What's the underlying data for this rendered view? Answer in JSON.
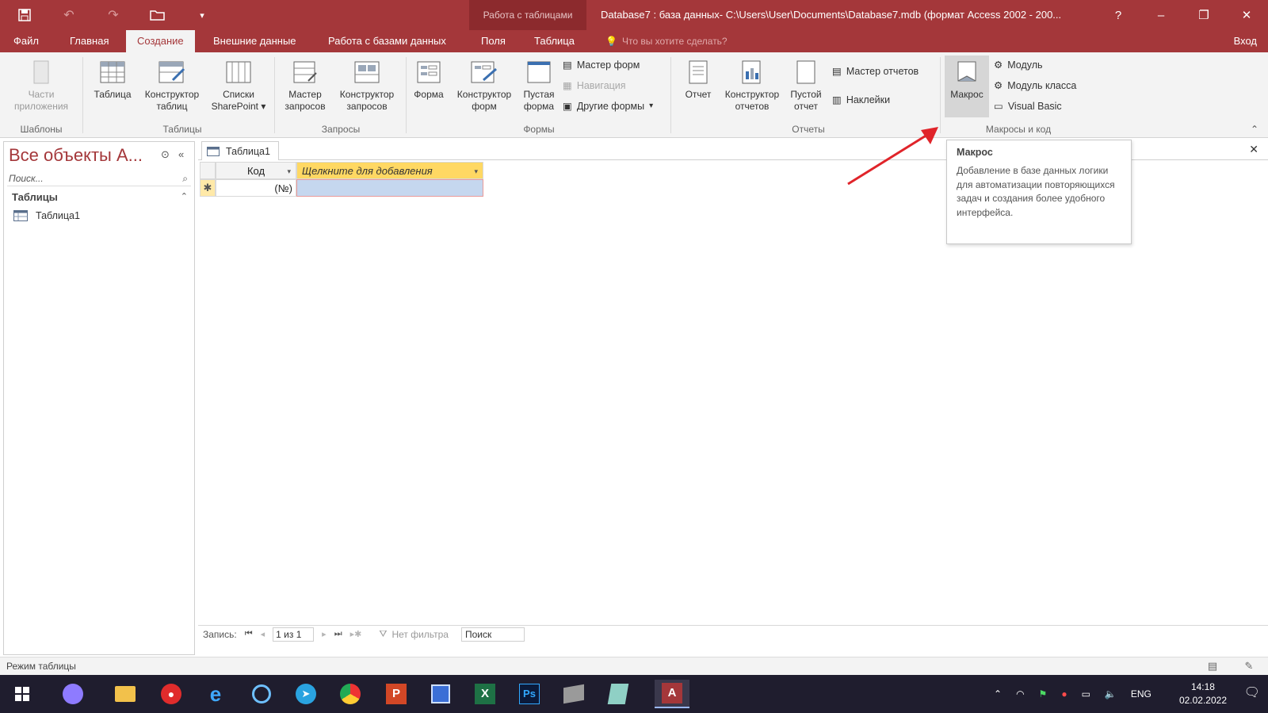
{
  "titlebar": {
    "context_tab": "Работа с таблицами",
    "title": "Database7 : база данных- C:\\Users\\User\\Documents\\Database7.mdb (формат Access 2002 - 200...",
    "help": "?"
  },
  "menu": {
    "items": [
      "Файл",
      "Главная",
      "Создание",
      "Внешние данные",
      "Работа с базами данных",
      "Поля",
      "Таблица"
    ],
    "active": "Создание",
    "tellme": "Что вы хотите сделать?",
    "signin": "Вход"
  },
  "ribbon": {
    "templates": {
      "parts": "Части приложения",
      "group": "Шаблоны"
    },
    "tables": {
      "table": "Таблица",
      "designer": "Конструктор таблиц",
      "sharepoint": "Списки SharePoint",
      "group": "Таблицы"
    },
    "queries": {
      "wizard": "Мастер запросов",
      "designer": "Конструктор запросов",
      "group": "Запросы"
    },
    "forms": {
      "form": "Форма",
      "designer": "Конструктор форм",
      "blank": "Пустая форма",
      "wizard": "Мастер форм",
      "navigation": "Навигация",
      "more": "Другие формы",
      "group": "Формы"
    },
    "reports": {
      "report": "Отчет",
      "designer": "Конструктор отчетов",
      "blank": "Пустой отчет",
      "wizard": "Мастер отчетов",
      "labels": "Наклейки",
      "group": "Отчеты"
    },
    "macros": {
      "macro": "Макрос",
      "module": "Модуль",
      "class_module": "Модуль класса",
      "vba": "Visual Basic",
      "group": "Макросы и код"
    }
  },
  "navpane": {
    "title": "Все объекты A...",
    "search_placeholder": "Поиск...",
    "group": "Таблицы",
    "items": [
      "Таблица1"
    ]
  },
  "document": {
    "tab": "Таблица1",
    "columns": [
      "Код",
      "Щелкните для добавления"
    ],
    "new_row": {
      "selector": "✱",
      "kod": "(№)"
    },
    "record_nav": {
      "label": "Запись:",
      "position": "1 из 1",
      "filter": "Нет фильтра",
      "search": "Поиск"
    }
  },
  "tooltip": {
    "title": "Макрос",
    "body": "Добавление в базе данных логики для автоматизации повторяющихся задач и создания более удобного интерфейса."
  },
  "statusbar": {
    "mode": "Режим таблицы"
  },
  "taskbar": {
    "lang": "ENG",
    "time": "14:18",
    "date": "02.02.2022"
  },
  "colors": {
    "accent": "#a4373a",
    "header_yellow": "#ffd863",
    "selection": "#c5d7ef"
  }
}
